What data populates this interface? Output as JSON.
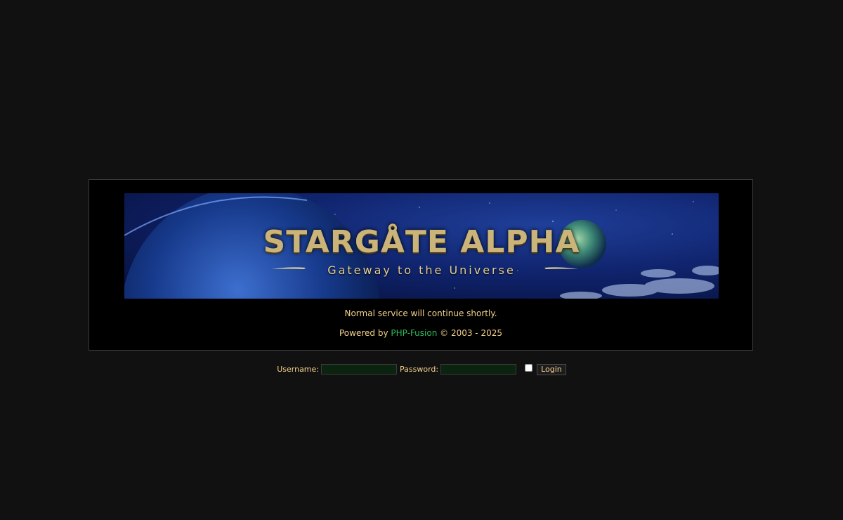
{
  "banner": {
    "title": "STARGÅTE ALPHA",
    "tagline": "Gateway to the Universe"
  },
  "messages": {
    "maintenance": "Normal service will continue shortly.",
    "powered_prefix": "Powered by ",
    "powered_link": "PHP-Fusion",
    "powered_suffix": " © 2003 - 2025"
  },
  "login": {
    "username_label": "Username:",
    "username_value": "",
    "password_label": "Password:",
    "password_value": "",
    "remember_checked": false,
    "submit_label": "Login"
  },
  "colors": {
    "background": "#111111",
    "panel": "#000000",
    "text": "#f2d28c",
    "link": "#2fb85a",
    "input_bg": "#0b2410"
  }
}
